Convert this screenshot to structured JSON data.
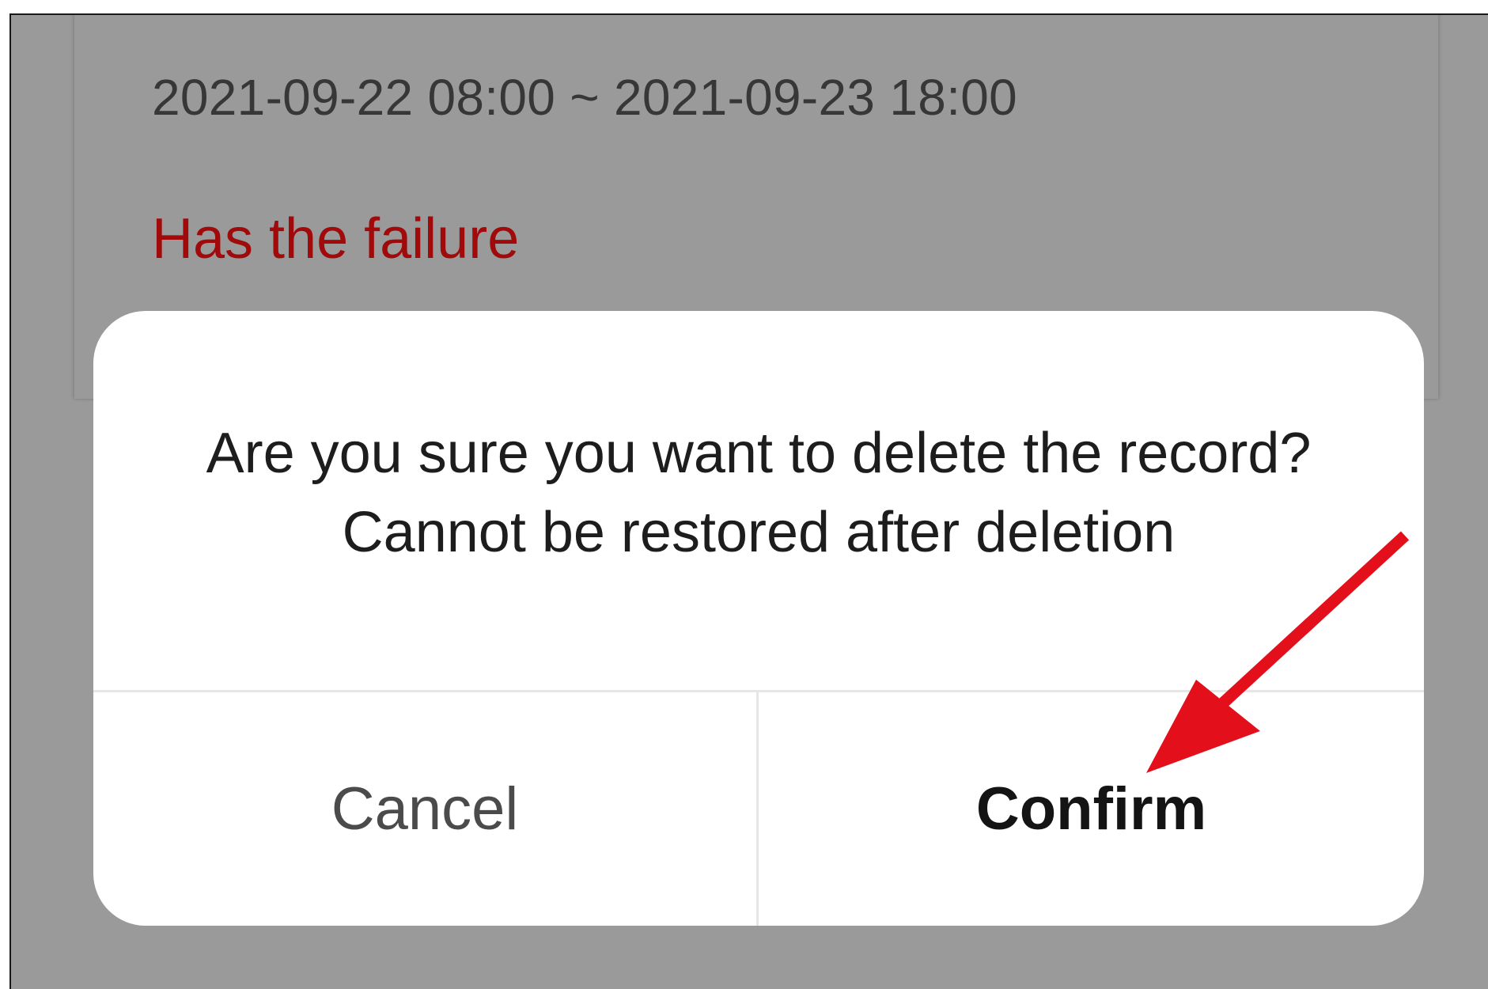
{
  "record": {
    "time_range": "2021-09-22 08:00 ~ 2021-09-23 18:00",
    "status": "Has the failure",
    "status_color": "#a00a0a"
  },
  "dialog": {
    "message": "Are you sure you want to delete the record? Cannot be restored after deletion",
    "cancel_label": "Cancel",
    "confirm_label": "Confirm"
  },
  "colors": {
    "overlay": "#9a9a9a",
    "dialog_background": "#ffffff",
    "annotation_arrow": "#e3101b"
  },
  "icons": {
    "annotation": "red-arrow-icon"
  }
}
